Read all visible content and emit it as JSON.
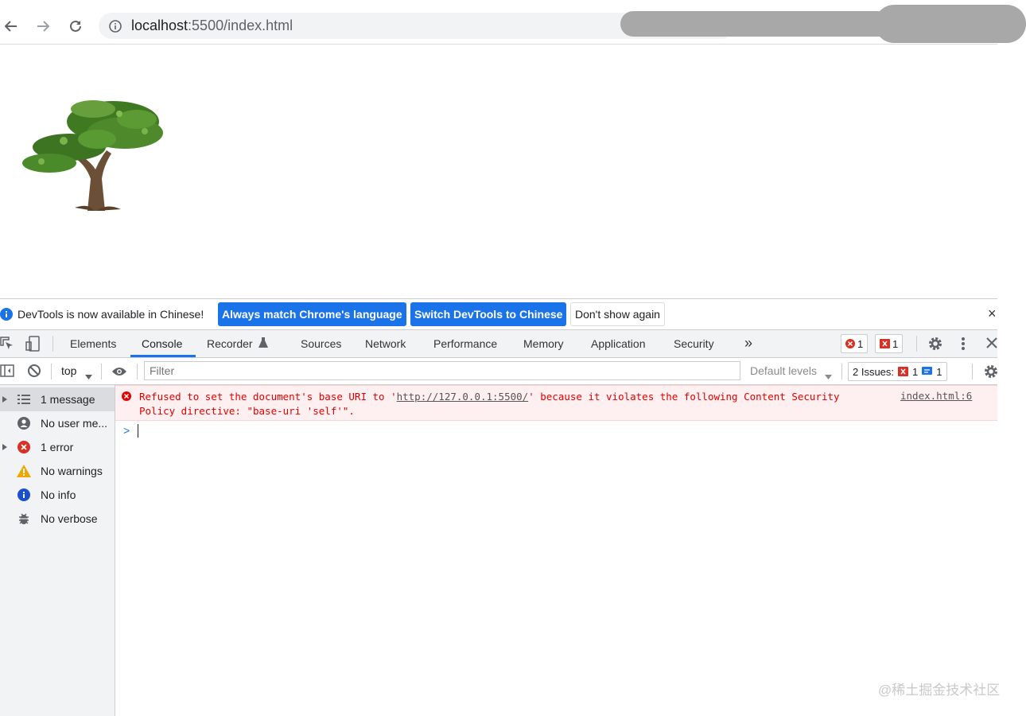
{
  "browser": {
    "url_host": "localhost",
    "url_rest": ":5500/index.html",
    "back_icon": "arrow-left-icon",
    "forward_icon": "arrow-right-icon",
    "reload_icon": "reload-icon",
    "info_icon": "info-circle-icon"
  },
  "devtools": {
    "infobar": {
      "message": "DevTools is now available in Chinese!",
      "btn_match": "Always match Chrome's language",
      "btn_switch": "Switch DevTools to Chinese",
      "btn_dont_show": "Don't show again",
      "close": "×"
    },
    "tabs": [
      "Elements",
      "Console",
      "Recorder",
      "Sources",
      "Network",
      "Performance",
      "Memory",
      "Application",
      "Security"
    ],
    "more_tabs": "»",
    "error_count": "1",
    "issue_count": "1",
    "console_toolbar": {
      "context": "top",
      "filter_placeholder": "Filter",
      "levels": "Default levels",
      "issues_label": "2 Issues:",
      "issues_errors": "1",
      "issues_info": "1"
    },
    "sidebar": [
      {
        "label": "1 message",
        "icon": "list-icon",
        "expandable": true,
        "selected": true
      },
      {
        "label": "No user me...",
        "icon": "user-icon",
        "expandable": false,
        "selected": false
      },
      {
        "label": "1 error",
        "icon": "error-icon",
        "expandable": true,
        "selected": false
      },
      {
        "label": "No warnings",
        "icon": "warning-icon",
        "expandable": false,
        "selected": false
      },
      {
        "label": "No info",
        "icon": "info-icon",
        "expandable": false,
        "selected": false
      },
      {
        "label": "No verbose",
        "icon": "bug-icon",
        "expandable": false,
        "selected": false
      }
    ],
    "error_message": {
      "text_before": "Refused to set the document's base URI to '",
      "link": "http://127.0.0.1:5500/",
      "text_after": "' because it violates the following Content Security Policy directive: \"base-uri 'self'\".",
      "source": "index.html:6"
    },
    "prompt": ">"
  },
  "colors": {
    "accent": "#1a73e8",
    "error": "#e50000",
    "error_bg": "#fef0f0",
    "warning": "#f2a600"
  },
  "watermark": "@稀土掘金技术社区"
}
